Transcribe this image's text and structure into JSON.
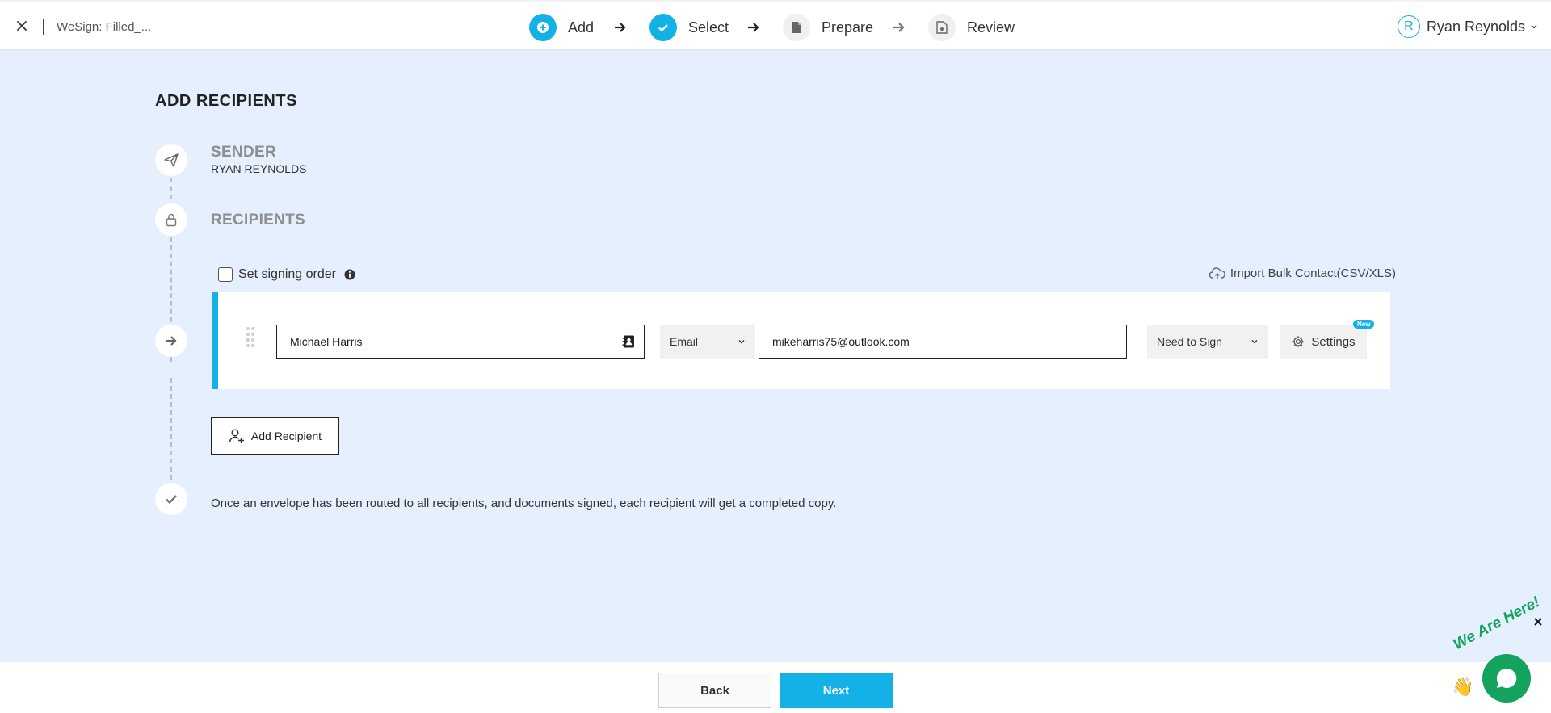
{
  "header": {
    "document_title": "WeSign: Filled_...",
    "steps": [
      {
        "label": "Add"
      },
      {
        "label": "Select"
      },
      {
        "label": "Prepare"
      },
      {
        "label": "Review"
      }
    ],
    "user": {
      "initial": "R",
      "name": "Ryan Reynolds"
    }
  },
  "main": {
    "title": "ADD RECIPIENTS",
    "sender": {
      "heading": "SENDER",
      "name": "RYAN REYNOLDS"
    },
    "recipients": {
      "heading": "RECIPIENTS",
      "signing_order_label": "Set signing order",
      "import_label": "Import Bulk Contact(CSV/XLS)",
      "rows": [
        {
          "name": "Michael Harris",
          "delivery_method": "Email",
          "email": "mikeharris75@outlook.com",
          "role": "Need to Sign",
          "settings_label": "Settings",
          "badge": "New"
        }
      ],
      "add_recipient_label": "Add Recipient"
    },
    "completion_note": "Once an envelope has been routed to all recipients, and documents signed, each recipient will get a completed copy."
  },
  "footer": {
    "back_label": "Back",
    "next_label": "Next"
  },
  "chat": {
    "tagline": "We Are Here!"
  },
  "colors": {
    "accent": "#14b1e7",
    "background": "#e5effd",
    "chat": "#13a35e"
  }
}
